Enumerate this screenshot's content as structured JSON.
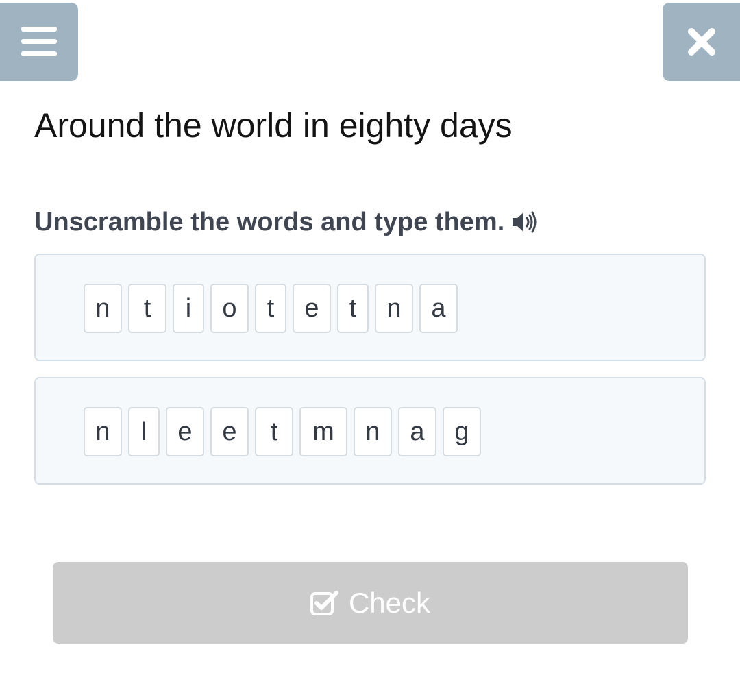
{
  "header": {
    "menu_icon": "hamburger-menu-icon",
    "close_icon": "close-icon",
    "button_color": "#9fb3c1"
  },
  "title": "Around the world in eighty days",
  "instruction": {
    "text": "Unscramble the words and type them.",
    "audio_icon": "speaker-icon"
  },
  "words": [
    {
      "letters": [
        "n",
        "t",
        "i",
        "o",
        "t",
        "e",
        "t",
        "n",
        "a"
      ]
    },
    {
      "letters": [
        "n",
        "l",
        "e",
        "e",
        "t",
        "m",
        "n",
        "a",
        "g"
      ]
    }
  ],
  "check_button": {
    "label": "Check",
    "icon": "checkbox-check-icon",
    "state": "disabled",
    "color": "#cccccc"
  }
}
